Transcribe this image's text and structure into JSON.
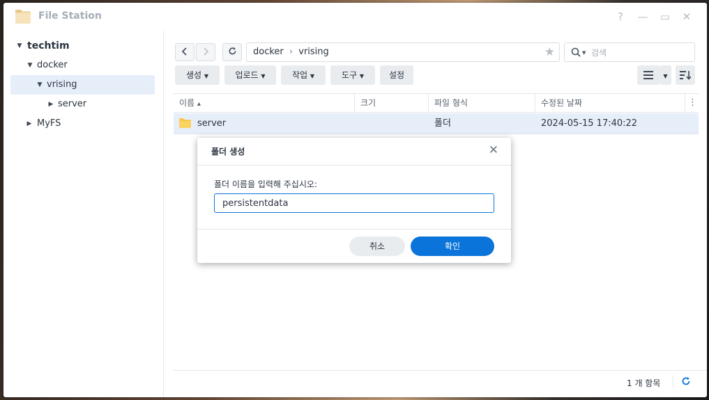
{
  "window": {
    "title": "File Station",
    "controls": [
      "?",
      "—",
      "▭",
      "✕"
    ]
  },
  "sidebar": {
    "items": [
      {
        "label": "techtim"
      },
      {
        "label": "docker"
      },
      {
        "label": "vrising"
      },
      {
        "label": "server"
      },
      {
        "label": "MyFS"
      }
    ]
  },
  "toolbar": {
    "path": [
      "docker",
      "vrising"
    ],
    "path_separator": "›",
    "search_placeholder": "검색",
    "buttons": [
      "생성",
      "업로드",
      "작업",
      "도구",
      "설정"
    ]
  },
  "grid": {
    "columns": [
      "이름",
      "크기",
      "파일 형식",
      "수정된 날짜"
    ],
    "sort_indicator": "▴",
    "rows": [
      {
        "name": "server",
        "size": "",
        "type": "폴더",
        "modified": "2024-05-15 17:40:22"
      }
    ]
  },
  "footer": {
    "count": "1 개 항목"
  },
  "dialog": {
    "title": "폴더 생성",
    "label": "폴더 이름을 입력해 주십시오:",
    "input_value": "persistentdata",
    "cancel_label": "취소",
    "ok_label": "확인"
  },
  "colors": {
    "accent": "#0a74da",
    "selection": "#e6eefa",
    "folder": "#f7c646"
  }
}
